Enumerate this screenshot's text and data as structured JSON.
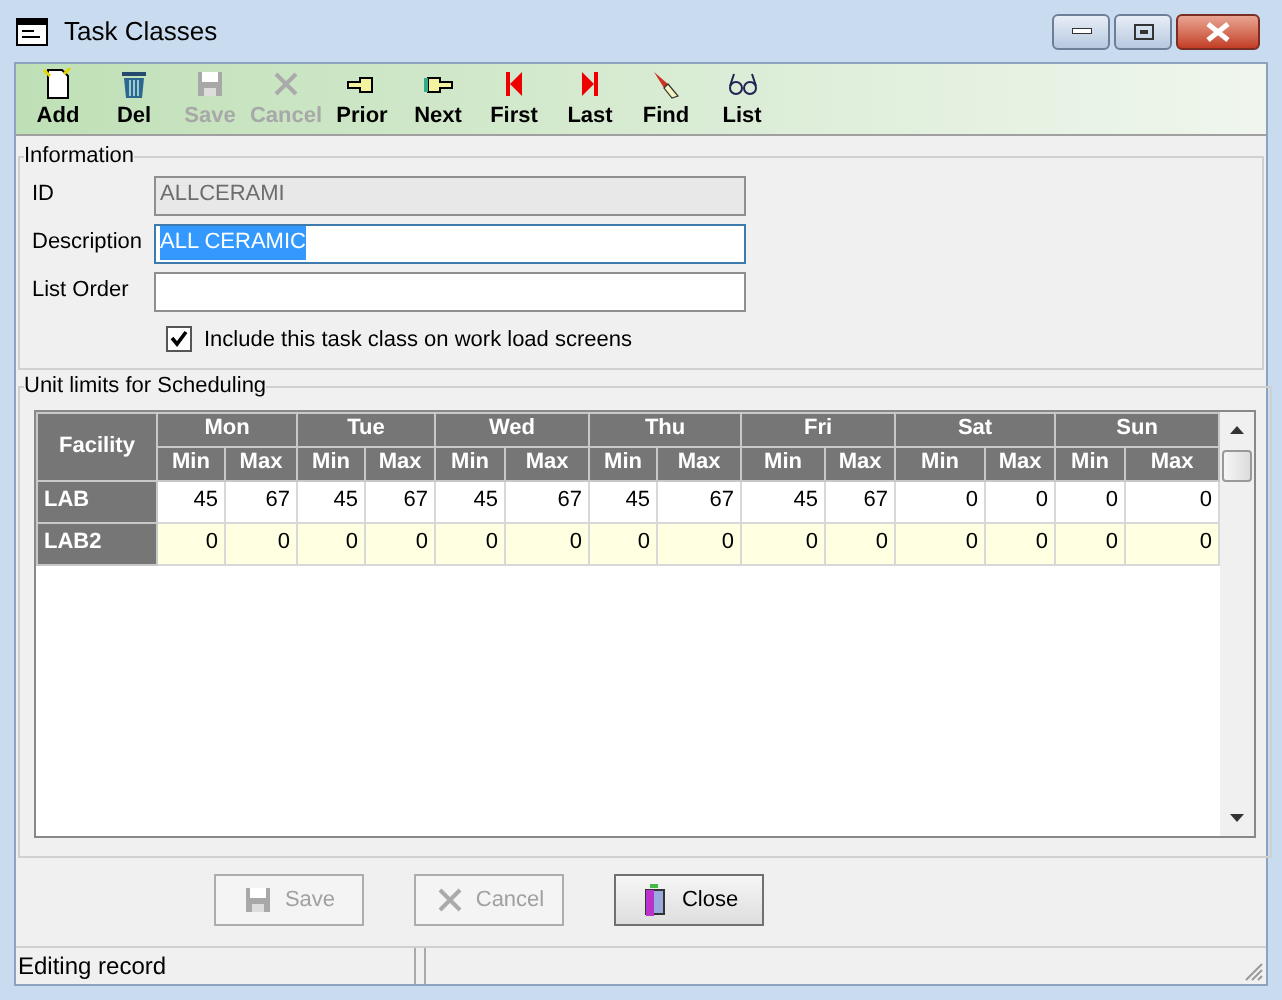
{
  "window": {
    "title": "Task Classes"
  },
  "toolbar": [
    {
      "label": "Add",
      "kind": "add",
      "disabled": false
    },
    {
      "label": "Del",
      "kind": "del",
      "disabled": false
    },
    {
      "label": "Save",
      "kind": "save",
      "disabled": true
    },
    {
      "label": "Cancel",
      "kind": "cancel",
      "disabled": true
    },
    {
      "label": "Prior",
      "kind": "prior",
      "disabled": false
    },
    {
      "label": "Next",
      "kind": "next",
      "disabled": false
    },
    {
      "label": "First",
      "kind": "first",
      "disabled": false
    },
    {
      "label": "Last",
      "kind": "last",
      "disabled": false
    },
    {
      "label": "Find",
      "kind": "find",
      "disabled": false
    },
    {
      "label": "List",
      "kind": "list",
      "disabled": false
    }
  ],
  "information": {
    "title": "Information",
    "fields": [
      {
        "label": "ID",
        "value": "ALLCERAMI",
        "disabled": true,
        "selected": false
      },
      {
        "label": "Description",
        "value": "ALL CERAMIC",
        "disabled": false,
        "selected": true
      },
      {
        "label": "List Order",
        "disabled": false,
        "selected": false
      }
    ],
    "checkbox": {
      "label": "Include this task class on work load screens",
      "checked": true
    }
  },
  "unit_limits": {
    "title": "Unit limits for Scheduling",
    "facility_header": "Facility",
    "days": [
      "Mon",
      "Tue",
      "Wed",
      "Thu",
      "Fri",
      "Sat",
      "Sun"
    ],
    "sub_headers": [
      "Min",
      "Max",
      "Min",
      "Max",
      "Min",
      "Max",
      "Min",
      "Max",
      "Min",
      "Max",
      "Min",
      "Max",
      "Min",
      "Max"
    ],
    "rows": [
      {
        "facility": "LAB",
        "values": [
          "45",
          "67",
          "45",
          "67",
          "45",
          "67",
          "45",
          "67",
          "45",
          "67",
          "0",
          "0",
          "0",
          "0"
        ],
        "selected": false
      },
      {
        "facility": "LAB2",
        "values": [
          "0",
          "0",
          "0",
          "0",
          "0",
          "0",
          "0",
          "0",
          "0",
          "0",
          "0",
          "0",
          "0",
          "0"
        ],
        "selected": true
      }
    ]
  },
  "buttons": [
    {
      "label": "Save",
      "kind": "save",
      "disabled": true
    },
    {
      "label": "Cancel",
      "kind": "cancel",
      "disabled": true
    },
    {
      "label": "Close",
      "kind": "close",
      "disabled": false
    }
  ],
  "status_bar": [
    "Editing record"
  ]
}
